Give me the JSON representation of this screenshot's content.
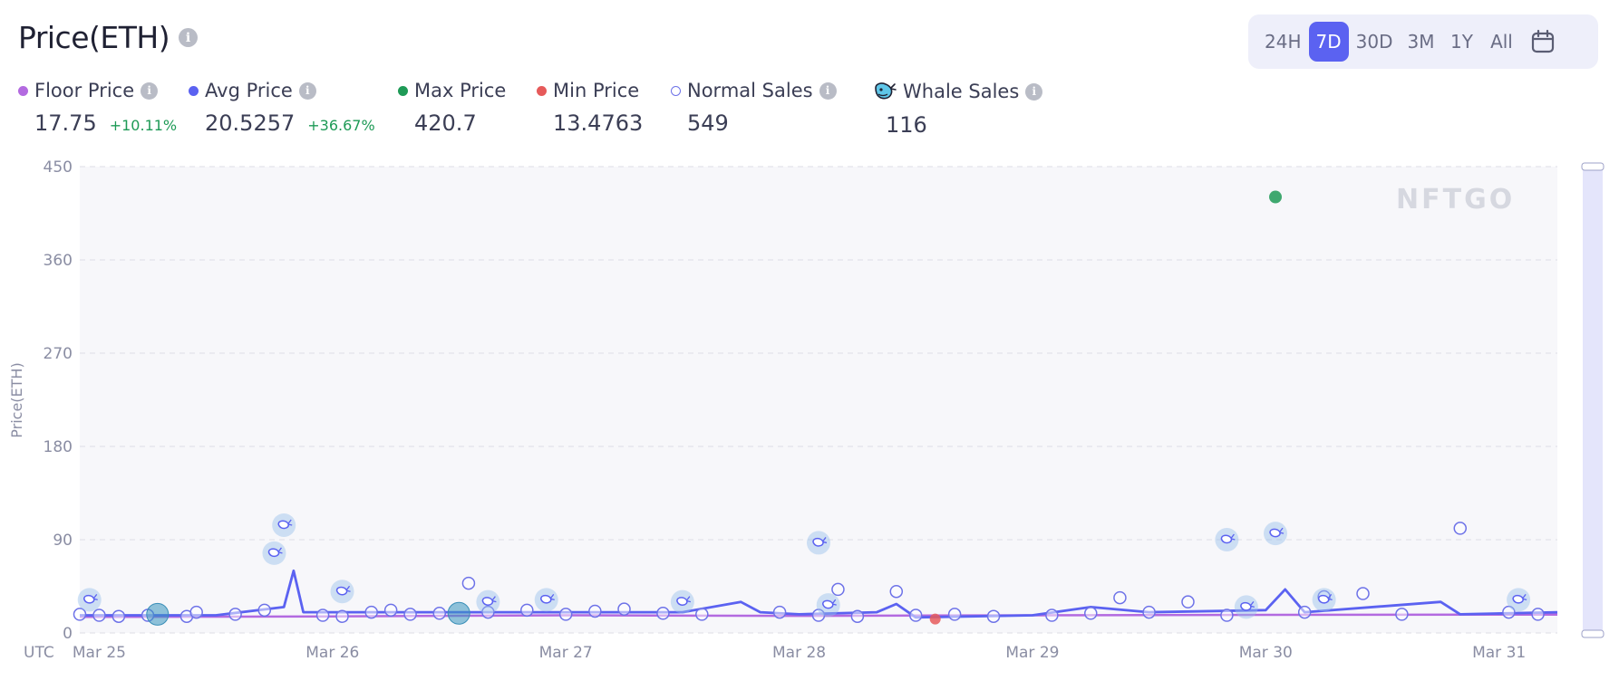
{
  "header": {
    "title": "Price(ETH)"
  },
  "ranges": {
    "items": [
      "24H",
      "7D",
      "30D",
      "3M",
      "1Y",
      "All"
    ],
    "active": "7D"
  },
  "legend": {
    "floor": {
      "label": "Floor Price",
      "value": "17.75",
      "change": "+10.11%",
      "color": "#b36ae0"
    },
    "avg": {
      "label": "Avg Price",
      "value": "20.5257",
      "change": "+36.67%",
      "color": "#5b62f1"
    },
    "max": {
      "label": "Max Price",
      "value": "420.7",
      "color": "#1e9a56"
    },
    "min": {
      "label": "Min Price",
      "value": "13.4763",
      "color": "#e65a5a"
    },
    "normal": {
      "label": "Normal Sales",
      "value": "549"
    },
    "whale": {
      "label": "Whale Sales",
      "value": "116"
    }
  },
  "watermark": "NFTGO",
  "chart_data": {
    "type": "scatter",
    "ylabel": "Price(ETH)",
    "ylim": [
      0,
      450
    ],
    "yticks": [
      0,
      90,
      180,
      270,
      360,
      450
    ],
    "timezone_label": "UTC",
    "xlim": [
      "Mar 24 22:00",
      "Mar 31 06:00"
    ],
    "xticks": [
      {
        "label": "Mar 25",
        "t": "Mar 25 00:00"
      },
      {
        "label": "Mar 26",
        "t": "Mar 26 00:00"
      },
      {
        "label": "Mar 27",
        "t": "Mar 27 00:00"
      },
      {
        "label": "Mar 28",
        "t": "Mar 28 00:00"
      },
      {
        "label": "Mar 29",
        "t": "Mar 29 00:00"
      },
      {
        "label": "Mar 30",
        "t": "Mar 30 00:00"
      },
      {
        "label": "Mar 31",
        "t": "Mar 31 00:00"
      }
    ],
    "grid": true,
    "floor_price_line": [
      {
        "t": "Mar 24 22:00",
        "y": 15.5
      },
      {
        "t": "Mar 26 00:00",
        "y": 16
      },
      {
        "t": "Mar 27 00:00",
        "y": 17
      },
      {
        "t": "Mar 28 00:00",
        "y": 16.5
      },
      {
        "t": "Mar 29 00:00",
        "y": 17
      },
      {
        "t": "Mar 30 00:00",
        "y": 17.5
      },
      {
        "t": "Mar 31 06:00",
        "y": 17.75
      }
    ],
    "avg_price_line": [
      {
        "t": "Mar 24 22:00",
        "y": 17
      },
      {
        "t": "Mar 25 12:00",
        "y": 17
      },
      {
        "t": "Mar 25 19:00",
        "y": 25
      },
      {
        "t": "Mar 25 20:00",
        "y": 60
      },
      {
        "t": "Mar 25 21:00",
        "y": 20
      },
      {
        "t": "Mar 26 12:00",
        "y": 20
      },
      {
        "t": "Mar 27 12:00",
        "y": 20
      },
      {
        "t": "Mar 27 18:00",
        "y": 30
      },
      {
        "t": "Mar 27 20:00",
        "y": 20
      },
      {
        "t": "Mar 28 00:00",
        "y": 18
      },
      {
        "t": "Mar 28 08:00",
        "y": 20
      },
      {
        "t": "Mar 28 10:00",
        "y": 28
      },
      {
        "t": "Mar 28 12:00",
        "y": 15
      },
      {
        "t": "Mar 29 00:00",
        "y": 17
      },
      {
        "t": "Mar 29 06:00",
        "y": 25
      },
      {
        "t": "Mar 29 12:00",
        "y": 20
      },
      {
        "t": "Mar 30 00:00",
        "y": 22
      },
      {
        "t": "Mar 30 02:00",
        "y": 42
      },
      {
        "t": "Mar 30 04:00",
        "y": 20
      },
      {
        "t": "Mar 30 18:00",
        "y": 30
      },
      {
        "t": "Mar 30 20:00",
        "y": 18
      },
      {
        "t": "Mar 31 06:00",
        "y": 20
      }
    ],
    "max_point": {
      "t": "Mar 30 01:00",
      "y": 420.7
    },
    "min_point": {
      "t": "Mar 28 14:00",
      "y": 13.4763
    },
    "highlight_sales": [
      {
        "t": "Mar 25 06:00",
        "y": 18
      },
      {
        "t": "Mar 26 13:00",
        "y": 19
      }
    ],
    "normal_sales": [
      {
        "t": "Mar 24 22:00",
        "y": 18
      },
      {
        "t": "Mar 25 00:00",
        "y": 17
      },
      {
        "t": "Mar 25 02:00",
        "y": 16
      },
      {
        "t": "Mar 25 05:00",
        "y": 17
      },
      {
        "t": "Mar 25 09:00",
        "y": 16
      },
      {
        "t": "Mar 25 10:00",
        "y": 20
      },
      {
        "t": "Mar 25 14:00",
        "y": 18
      },
      {
        "t": "Mar 25 17:00",
        "y": 22
      },
      {
        "t": "Mar 25 23:00",
        "y": 17
      },
      {
        "t": "Mar 26 01:00",
        "y": 16
      },
      {
        "t": "Mar 26 04:00",
        "y": 20
      },
      {
        "t": "Mar 26 06:00",
        "y": 22
      },
      {
        "t": "Mar 26 08:00",
        "y": 18
      },
      {
        "t": "Mar 26 11:00",
        "y": 19
      },
      {
        "t": "Mar 26 14:00",
        "y": 48
      },
      {
        "t": "Mar 26 16:00",
        "y": 20
      },
      {
        "t": "Mar 26 20:00",
        "y": 22
      },
      {
        "t": "Mar 27 00:00",
        "y": 18
      },
      {
        "t": "Mar 27 03:00",
        "y": 21
      },
      {
        "t": "Mar 27 06:00",
        "y": 23
      },
      {
        "t": "Mar 27 10:00",
        "y": 19
      },
      {
        "t": "Mar 27 14:00",
        "y": 18
      },
      {
        "t": "Mar 27 22:00",
        "y": 20
      },
      {
        "t": "Mar 28 02:00",
        "y": 17
      },
      {
        "t": "Mar 28 04:00",
        "y": 42
      },
      {
        "t": "Mar 28 06:00",
        "y": 16
      },
      {
        "t": "Mar 28 10:00",
        "y": 40
      },
      {
        "t": "Mar 28 12:00",
        "y": 17
      },
      {
        "t": "Mar 28 16:00",
        "y": 18
      },
      {
        "t": "Mar 28 20:00",
        "y": 16
      },
      {
        "t": "Mar 29 02:00",
        "y": 17
      },
      {
        "t": "Mar 29 06:00",
        "y": 19
      },
      {
        "t": "Mar 29 09:00",
        "y": 34
      },
      {
        "t": "Mar 29 12:00",
        "y": 20
      },
      {
        "t": "Mar 29 16:00",
        "y": 30
      },
      {
        "t": "Mar 29 20:00",
        "y": 17
      },
      {
        "t": "Mar 30 04:00",
        "y": 20
      },
      {
        "t": "Mar 30 06:00",
        "y": 35
      },
      {
        "t": "Mar 30 10:00",
        "y": 38
      },
      {
        "t": "Mar 30 14:00",
        "y": 18
      },
      {
        "t": "Mar 30 20:00",
        "y": 101
      },
      {
        "t": "Mar 31 01:00",
        "y": 20
      },
      {
        "t": "Mar 31 04:00",
        "y": 18
      }
    ],
    "whale_sales": [
      {
        "t": "Mar 24 23:00",
        "y": 32
      },
      {
        "t": "Mar 25 18:00",
        "y": 77
      },
      {
        "t": "Mar 25 19:00",
        "y": 104
      },
      {
        "t": "Mar 26 01:00",
        "y": 40
      },
      {
        "t": "Mar 26 16:00",
        "y": 30
      },
      {
        "t": "Mar 26 22:00",
        "y": 32
      },
      {
        "t": "Mar 27 12:00",
        "y": 30
      },
      {
        "t": "Mar 28 02:00",
        "y": 87
      },
      {
        "t": "Mar 28 03:00",
        "y": 27
      },
      {
        "t": "Mar 29 20:00",
        "y": 90
      },
      {
        "t": "Mar 29 22:00",
        "y": 25
      },
      {
        "t": "Mar 30 01:00",
        "y": 96
      },
      {
        "t": "Mar 30 06:00",
        "y": 32
      },
      {
        "t": "Mar 31 02:00",
        "y": 32
      }
    ]
  }
}
